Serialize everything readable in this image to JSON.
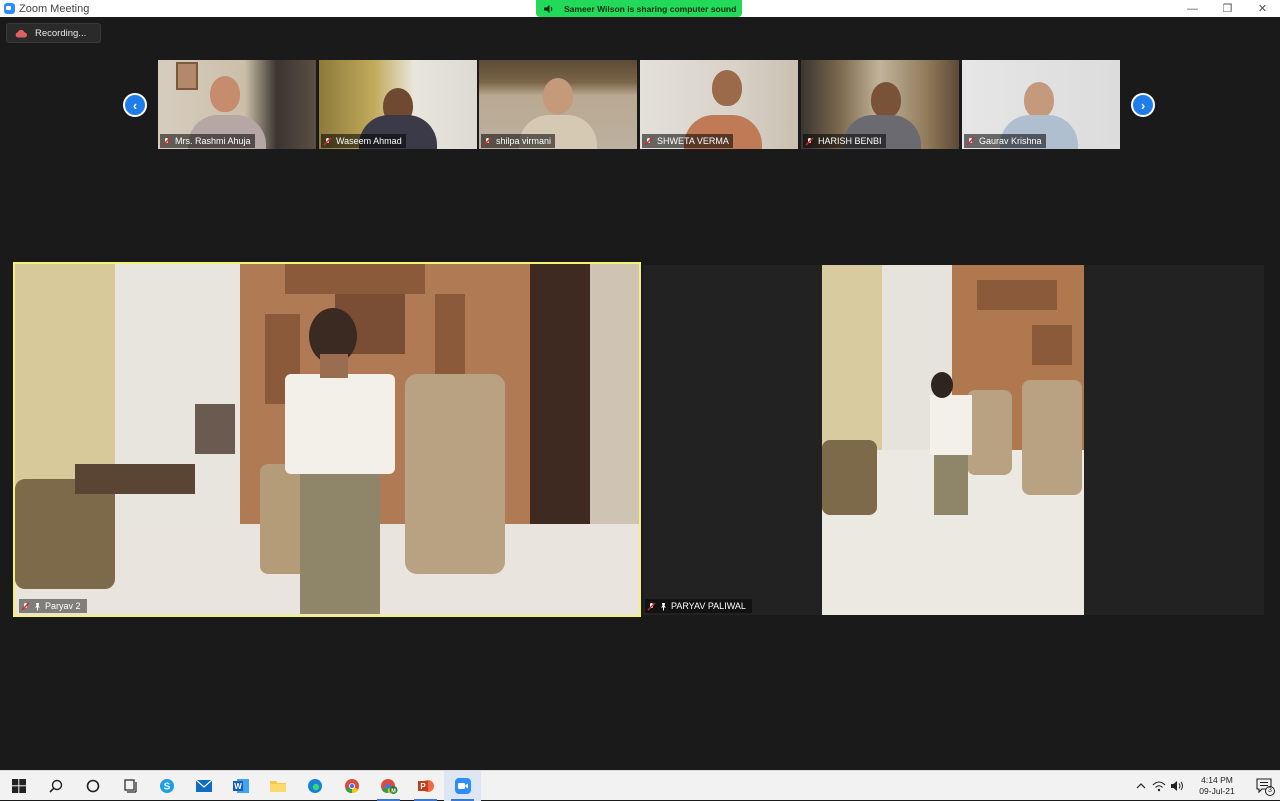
{
  "window": {
    "title": "Zoom Meeting"
  },
  "banner": {
    "text": "Sameer Wilson is sharing computer sound"
  },
  "recording": {
    "label": "Recording..."
  },
  "thumbnails": [
    {
      "name": "Mrs. Rashmi Ahuja",
      "muted": true
    },
    {
      "name": "Waseem Ahmad",
      "muted": true
    },
    {
      "name": "shilpa virmani",
      "muted": true
    },
    {
      "name": "SHWETA VERMA",
      "muted": true
    },
    {
      "name": "HARISH BENBI",
      "muted": true
    },
    {
      "name": "Gaurav Krishna",
      "muted": true
    }
  ],
  "videos": {
    "main": {
      "name": "Paryav 2",
      "muted": true,
      "pinned": true
    },
    "secondary": {
      "name": "PARYAV PALIWAL",
      "muted": true,
      "pinned": true
    }
  },
  "taskbar": {
    "apps": [
      "start-icon",
      "search-icon",
      "cortana-icon",
      "task-view-icon",
      "skype-icon",
      "mail-icon",
      "word-icon",
      "file-explorer-icon",
      "edge-icon",
      "chrome-icon",
      "chrome-profile-icon",
      "powerpoint-icon",
      "zoom-icon"
    ],
    "clock": {
      "time": "4:14 PM",
      "date": "09-Jul-21"
    },
    "notification_count": "3"
  },
  "colors": {
    "accent": "#2d8cff",
    "banner": "#23d959",
    "active_border": "#f4f173",
    "background": "#1a1a1a"
  }
}
